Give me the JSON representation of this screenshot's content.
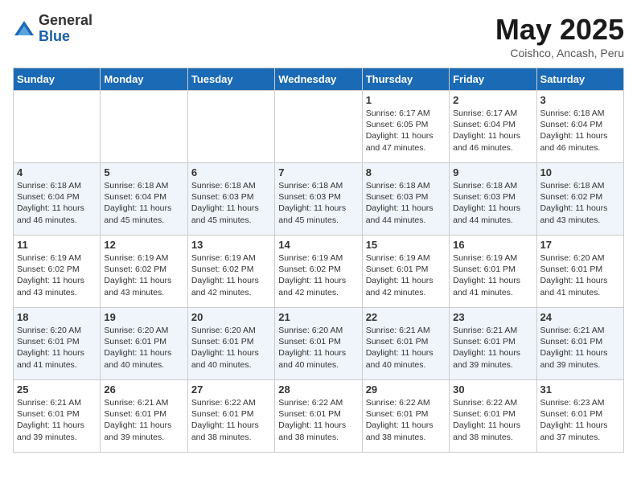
{
  "header": {
    "logo_general": "General",
    "logo_blue": "Blue",
    "title": "May 2025",
    "subtitle": "Coishco, Ancash, Peru"
  },
  "days_of_week": [
    "Sunday",
    "Monday",
    "Tuesday",
    "Wednesday",
    "Thursday",
    "Friday",
    "Saturday"
  ],
  "weeks": [
    [
      {
        "day": "",
        "lines": []
      },
      {
        "day": "",
        "lines": []
      },
      {
        "day": "",
        "lines": []
      },
      {
        "day": "",
        "lines": []
      },
      {
        "day": "1",
        "lines": [
          "Sunrise: 6:17 AM",
          "Sunset: 6:05 PM",
          "Daylight: 11 hours",
          "and 47 minutes."
        ]
      },
      {
        "day": "2",
        "lines": [
          "Sunrise: 6:17 AM",
          "Sunset: 6:04 PM",
          "Daylight: 11 hours",
          "and 46 minutes."
        ]
      },
      {
        "day": "3",
        "lines": [
          "Sunrise: 6:18 AM",
          "Sunset: 6:04 PM",
          "Daylight: 11 hours",
          "and 46 minutes."
        ]
      }
    ],
    [
      {
        "day": "4",
        "lines": [
          "Sunrise: 6:18 AM",
          "Sunset: 6:04 PM",
          "Daylight: 11 hours",
          "and 46 minutes."
        ]
      },
      {
        "day": "5",
        "lines": [
          "Sunrise: 6:18 AM",
          "Sunset: 6:04 PM",
          "Daylight: 11 hours",
          "and 45 minutes."
        ]
      },
      {
        "day": "6",
        "lines": [
          "Sunrise: 6:18 AM",
          "Sunset: 6:03 PM",
          "Daylight: 11 hours",
          "and 45 minutes."
        ]
      },
      {
        "day": "7",
        "lines": [
          "Sunrise: 6:18 AM",
          "Sunset: 6:03 PM",
          "Daylight: 11 hours",
          "and 45 minutes."
        ]
      },
      {
        "day": "8",
        "lines": [
          "Sunrise: 6:18 AM",
          "Sunset: 6:03 PM",
          "Daylight: 11 hours",
          "and 44 minutes."
        ]
      },
      {
        "day": "9",
        "lines": [
          "Sunrise: 6:18 AM",
          "Sunset: 6:03 PM",
          "Daylight: 11 hours",
          "and 44 minutes."
        ]
      },
      {
        "day": "10",
        "lines": [
          "Sunrise: 6:18 AM",
          "Sunset: 6:02 PM",
          "Daylight: 11 hours",
          "and 43 minutes."
        ]
      }
    ],
    [
      {
        "day": "11",
        "lines": [
          "Sunrise: 6:19 AM",
          "Sunset: 6:02 PM",
          "Daylight: 11 hours",
          "and 43 minutes."
        ]
      },
      {
        "day": "12",
        "lines": [
          "Sunrise: 6:19 AM",
          "Sunset: 6:02 PM",
          "Daylight: 11 hours",
          "and 43 minutes."
        ]
      },
      {
        "day": "13",
        "lines": [
          "Sunrise: 6:19 AM",
          "Sunset: 6:02 PM",
          "Daylight: 11 hours",
          "and 42 minutes."
        ]
      },
      {
        "day": "14",
        "lines": [
          "Sunrise: 6:19 AM",
          "Sunset: 6:02 PM",
          "Daylight: 11 hours",
          "and 42 minutes."
        ]
      },
      {
        "day": "15",
        "lines": [
          "Sunrise: 6:19 AM",
          "Sunset: 6:01 PM",
          "Daylight: 11 hours",
          "and 42 minutes."
        ]
      },
      {
        "day": "16",
        "lines": [
          "Sunrise: 6:19 AM",
          "Sunset: 6:01 PM",
          "Daylight: 11 hours",
          "and 41 minutes."
        ]
      },
      {
        "day": "17",
        "lines": [
          "Sunrise: 6:20 AM",
          "Sunset: 6:01 PM",
          "Daylight: 11 hours",
          "and 41 minutes."
        ]
      }
    ],
    [
      {
        "day": "18",
        "lines": [
          "Sunrise: 6:20 AM",
          "Sunset: 6:01 PM",
          "Daylight: 11 hours",
          "and 41 minutes."
        ]
      },
      {
        "day": "19",
        "lines": [
          "Sunrise: 6:20 AM",
          "Sunset: 6:01 PM",
          "Daylight: 11 hours",
          "and 40 minutes."
        ]
      },
      {
        "day": "20",
        "lines": [
          "Sunrise: 6:20 AM",
          "Sunset: 6:01 PM",
          "Daylight: 11 hours",
          "and 40 minutes."
        ]
      },
      {
        "day": "21",
        "lines": [
          "Sunrise: 6:20 AM",
          "Sunset: 6:01 PM",
          "Daylight: 11 hours",
          "and 40 minutes."
        ]
      },
      {
        "day": "22",
        "lines": [
          "Sunrise: 6:21 AM",
          "Sunset: 6:01 PM",
          "Daylight: 11 hours",
          "and 40 minutes."
        ]
      },
      {
        "day": "23",
        "lines": [
          "Sunrise: 6:21 AM",
          "Sunset: 6:01 PM",
          "Daylight: 11 hours",
          "and 39 minutes."
        ]
      },
      {
        "day": "24",
        "lines": [
          "Sunrise: 6:21 AM",
          "Sunset: 6:01 PM",
          "Daylight: 11 hours",
          "and 39 minutes."
        ]
      }
    ],
    [
      {
        "day": "25",
        "lines": [
          "Sunrise: 6:21 AM",
          "Sunset: 6:01 PM",
          "Daylight: 11 hours",
          "and 39 minutes."
        ]
      },
      {
        "day": "26",
        "lines": [
          "Sunrise: 6:21 AM",
          "Sunset: 6:01 PM",
          "Daylight: 11 hours",
          "and 39 minutes."
        ]
      },
      {
        "day": "27",
        "lines": [
          "Sunrise: 6:22 AM",
          "Sunset: 6:01 PM",
          "Daylight: 11 hours",
          "and 38 minutes."
        ]
      },
      {
        "day": "28",
        "lines": [
          "Sunrise: 6:22 AM",
          "Sunset: 6:01 PM",
          "Daylight: 11 hours",
          "and 38 minutes."
        ]
      },
      {
        "day": "29",
        "lines": [
          "Sunrise: 6:22 AM",
          "Sunset: 6:01 PM",
          "Daylight: 11 hours",
          "and 38 minutes."
        ]
      },
      {
        "day": "30",
        "lines": [
          "Sunrise: 6:22 AM",
          "Sunset: 6:01 PM",
          "Daylight: 11 hours",
          "and 38 minutes."
        ]
      },
      {
        "day": "31",
        "lines": [
          "Sunrise: 6:23 AM",
          "Sunset: 6:01 PM",
          "Daylight: 11 hours",
          "and 37 minutes."
        ]
      }
    ]
  ]
}
